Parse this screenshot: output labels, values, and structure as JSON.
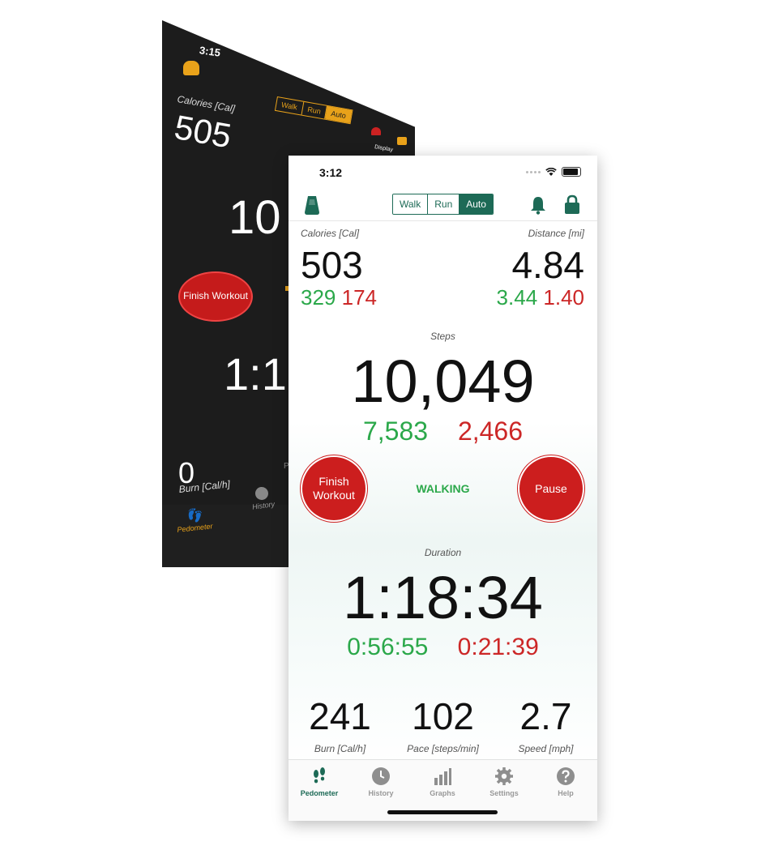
{
  "dark_phone": {
    "time": "3:15",
    "calories_label": "Calories [Cal]",
    "calories_value": "505",
    "modes": [
      "Walk",
      "Run",
      "Auto"
    ],
    "display_text": "Display",
    "steps_partial": "10",
    "finish_label": "Finish Workout",
    "duration_partial": "1:1",
    "burn_value": "0",
    "burn_label": "Burn [Cal/h]",
    "p_partial": "P",
    "tab_pedometer": "Pedometer",
    "tab_history": "History",
    "accent": "#e9a21a"
  },
  "status": {
    "time": "3:12"
  },
  "nav": {
    "modes": [
      "Walk",
      "Run",
      "Auto"
    ],
    "active_mode": "Auto",
    "accent": "#1d6a56"
  },
  "calories": {
    "label": "Calories [Cal]",
    "value": "503",
    "walk": "329",
    "run": "174"
  },
  "distance": {
    "label": "Distance [mi]",
    "value": "4.84",
    "walk": "3.44",
    "run": "1.40"
  },
  "steps": {
    "label": "Steps",
    "value": "10,049",
    "walk": "7,583",
    "run": "2,466"
  },
  "controls": {
    "finish_line1": "Finish",
    "finish_line2": "Workout",
    "pause": "Pause",
    "activity": "WALKING"
  },
  "duration": {
    "label": "Duration",
    "value": "1:18:34",
    "walk": "0:56:55",
    "run": "0:21:39"
  },
  "stats": [
    {
      "value": "241",
      "label": "Burn [Cal/h]"
    },
    {
      "value": "102",
      "label": "Pace [steps/min]"
    },
    {
      "value": "2.7",
      "label": "Speed [mph]"
    }
  ],
  "tabs": [
    {
      "label": "Pedometer",
      "icon": "feet-icon"
    },
    {
      "label": "History",
      "icon": "clock-icon"
    },
    {
      "label": "Graphs",
      "icon": "bar-graph-icon"
    },
    {
      "label": "Settings",
      "icon": "gear-icon"
    },
    {
      "label": "Help",
      "icon": "question-icon"
    }
  ],
  "colors": {
    "walk": "#2ba84a",
    "run": "#cc2727",
    "button_red": "#cc1e1e"
  }
}
